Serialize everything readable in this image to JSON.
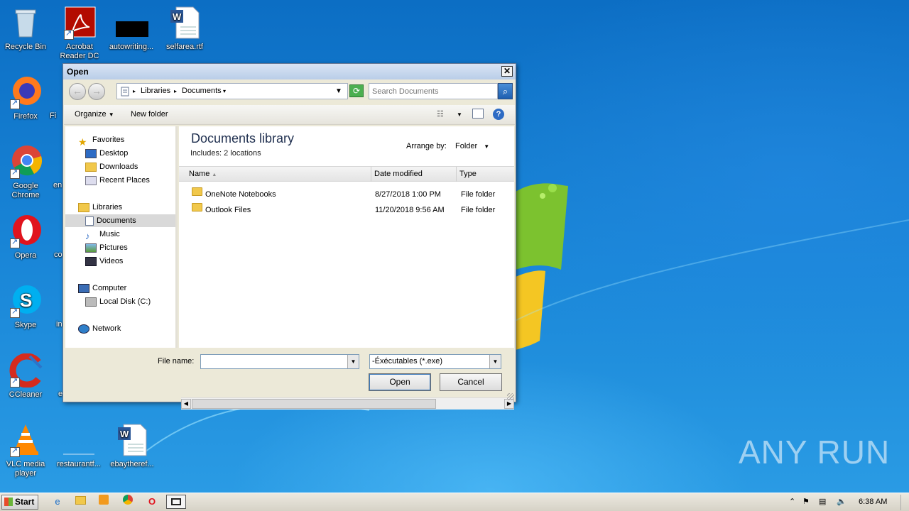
{
  "desktop": {
    "icons": [
      {
        "label": "Recycle Bin",
        "icon": "recycle-bin-icon"
      },
      {
        "label": "Acrobat Reader DC",
        "icon": "acrobat-icon"
      },
      {
        "label": "autowriting...",
        "icon": "blank-file-icon"
      },
      {
        "label": "selfarea.rtf",
        "icon": "word-document-icon"
      },
      {
        "label": "Firefox",
        "icon": "firefox-icon"
      },
      {
        "label": "Google Chrome",
        "icon": "chrome-icon"
      },
      {
        "label": "Opera",
        "icon": "opera-icon"
      },
      {
        "label": "Skype",
        "icon": "skype-icon"
      },
      {
        "label": "CCleaner",
        "icon": "ccleaner-icon"
      },
      {
        "label": "VLC media player",
        "icon": "vlc-icon"
      },
      {
        "label": "restaurantf...",
        "icon": "blank-file-icon"
      },
      {
        "label": "ebaytheref...",
        "icon": "word-document-icon"
      }
    ],
    "partial_labels": [
      "Fi",
      "en",
      "co",
      "in",
      "e"
    ],
    "watermark": "ANY  RUN"
  },
  "dialog": {
    "title": "Open",
    "close": "✕",
    "address": {
      "crumbs": [
        "Libraries",
        "Documents"
      ]
    },
    "search_placeholder": "Search Documents",
    "toolbar": {
      "organize": "Organize",
      "new_folder": "New folder"
    },
    "nav": {
      "favorites": "Favorites",
      "desktop": "Desktop",
      "downloads": "Downloads",
      "recent": "Recent Places",
      "libraries": "Libraries",
      "documents": "Documents",
      "music": "Music",
      "pictures": "Pictures",
      "videos": "Videos",
      "computer": "Computer",
      "local_disk": "Local Disk (C:)",
      "network": "Network"
    },
    "library": {
      "title": "Documents library",
      "includes": "Includes:  2 locations",
      "arrange_label": "Arrange by:",
      "arrange_value": "Folder"
    },
    "columns": {
      "name": "Name",
      "date": "Date modified",
      "type": "Type"
    },
    "files": [
      {
        "name": "OneNote Notebooks",
        "date": "8/27/2018 1:00 PM",
        "type": "File folder"
      },
      {
        "name": "Outlook Files",
        "date": "11/20/2018 9:56 AM",
        "type": "File folder"
      }
    ],
    "filename_label": "File name:",
    "filename_value": "",
    "filetype_value": "-Éxécutables  (*.exe)",
    "open_label": "Open",
    "cancel_label": "Cancel"
  },
  "taskbar": {
    "start": "Start",
    "clock": "6:38 AM"
  }
}
